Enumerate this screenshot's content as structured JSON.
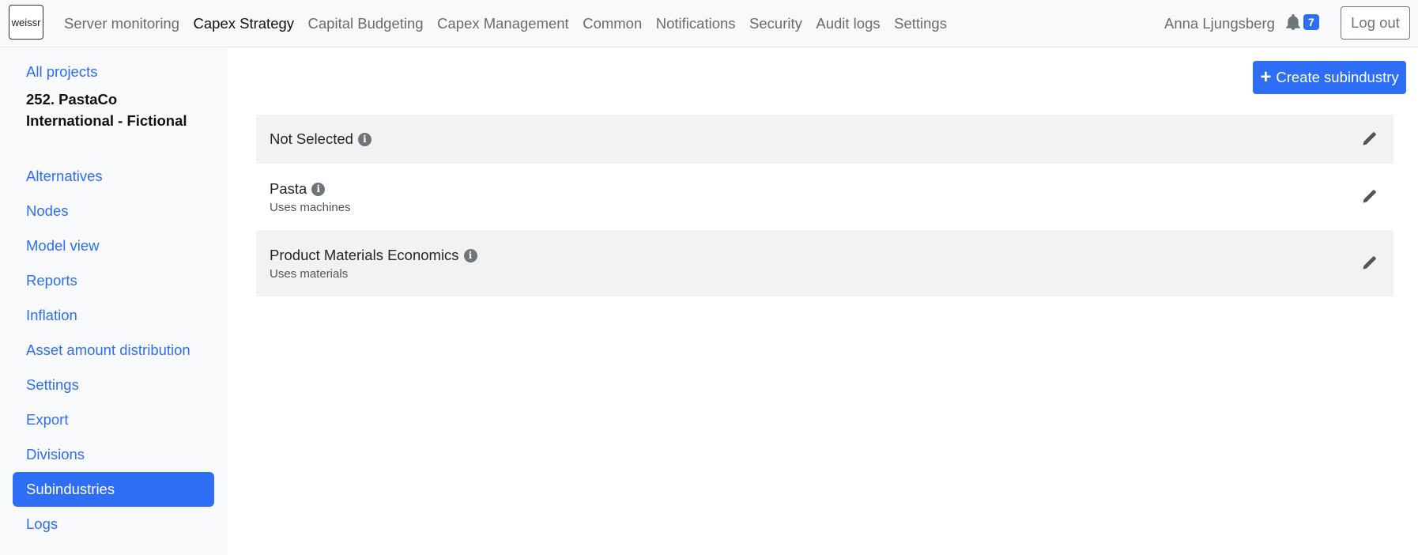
{
  "navbar": {
    "logo_text": "weissr",
    "links": [
      {
        "label": "Server monitoring",
        "active": false
      },
      {
        "label": "Capex Strategy",
        "active": true
      },
      {
        "label": "Capital Budgeting",
        "active": false
      },
      {
        "label": "Capex Management",
        "active": false
      },
      {
        "label": "Common",
        "active": false
      },
      {
        "label": "Notifications",
        "active": false
      },
      {
        "label": "Security",
        "active": false
      },
      {
        "label": "Audit logs",
        "active": false
      },
      {
        "label": "Settings",
        "active": false
      }
    ],
    "user_name": "Anna Ljungsberg",
    "notification_count": "7",
    "logout_label": "Log out",
    "accent_color": "#2d6ef5"
  },
  "sidebar": {
    "back_label": "All projects",
    "project_title": "252. PastaCo International - Fictional",
    "items": [
      {
        "label": "Alternatives",
        "active": false
      },
      {
        "label": "Nodes",
        "active": false
      },
      {
        "label": "Model view",
        "active": false
      },
      {
        "label": "Reports",
        "active": false
      },
      {
        "label": "Inflation",
        "active": false
      },
      {
        "label": "Asset amount distribution",
        "active": false
      },
      {
        "label": "Settings",
        "active": false
      },
      {
        "label": "Export",
        "active": false
      },
      {
        "label": "Divisions",
        "active": false
      },
      {
        "label": "Subindustries",
        "active": true
      },
      {
        "label": "Logs",
        "active": false
      }
    ]
  },
  "main": {
    "create_label": "Create subindustry",
    "subindustries": [
      {
        "name": "Not Selected",
        "description": ""
      },
      {
        "name": "Pasta",
        "description": "Uses machines"
      },
      {
        "name": "Product Materials Economics",
        "description": "Uses materials"
      }
    ],
    "icons": {
      "info": "info-icon",
      "edit": "pencil-icon",
      "bell": "bell-icon",
      "plus": "plus-icon"
    }
  }
}
